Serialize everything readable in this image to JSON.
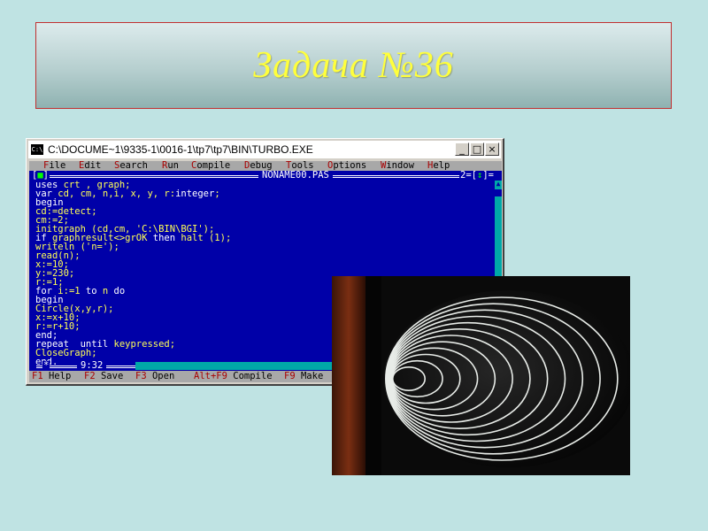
{
  "slide": {
    "title": "Задача №36",
    "background_color": "#bfe3e3",
    "title_color": "#ffff3c"
  },
  "window": {
    "title": "C:\\DOCUME~1\\9335-1\\0016-1\\tp7\\tp7\\BIN\\TURBO.EXE",
    "app_icon": "C:\\",
    "controls": {
      "minimize": "_",
      "maximize": "□",
      "close": "×"
    }
  },
  "ide": {
    "menu": [
      {
        "hot": "F",
        "rest": "ile"
      },
      {
        "hot": "E",
        "rest": "dit"
      },
      {
        "hot": "S",
        "rest": "earch"
      },
      {
        "hot": "R",
        "rest": "un"
      },
      {
        "hot": "C",
        "rest": "ompile"
      },
      {
        "hot": "D",
        "rest": "ebug"
      },
      {
        "hot": "T",
        "rest": "ools"
      },
      {
        "hot": "O",
        "rest": "ptions"
      },
      {
        "hot": "W",
        "rest": "indow"
      },
      {
        "hot": "H",
        "rest": "elp"
      }
    ],
    "close_box": {
      "left": "[",
      "mark": "■",
      "right": "]"
    },
    "filename": "NONAME00.PAS",
    "window_number": {
      "num": "2",
      "left": "=[",
      "mark": "↕",
      "right": "]="
    },
    "code": [
      [
        {
          "t": "uses ",
          "c": "kw"
        },
        {
          "t": "crt , graph;",
          "c": "id"
        }
      ],
      [
        {
          "t": "var ",
          "c": "kw"
        },
        {
          "t": "cd, cm, n,i, x, y, r:",
          "c": "id"
        },
        {
          "t": "integer",
          "c": "kw"
        },
        {
          "t": ";",
          "c": "id"
        }
      ],
      [
        {
          "t": "begin",
          "c": "kw"
        }
      ],
      [
        {
          "t": "cd:=detect;",
          "c": "id"
        }
      ],
      [
        {
          "t": "cm:=2;",
          "c": "id"
        }
      ],
      [
        {
          "t": "initgraph (cd,cm, 'C:\\BIN\\BGI');",
          "c": "id"
        }
      ],
      [
        {
          "t": "if ",
          "c": "kw"
        },
        {
          "t": "graphresult<>grOK ",
          "c": "id"
        },
        {
          "t": "then ",
          "c": "kw"
        },
        {
          "t": "halt (1);",
          "c": "id"
        }
      ],
      [
        {
          "t": "writeln ('n=');",
          "c": "id"
        }
      ],
      [
        {
          "t": "read(n);",
          "c": "id"
        }
      ],
      [
        {
          "t": "x:=10;",
          "c": "id"
        }
      ],
      [
        {
          "t": "y:=230;",
          "c": "id"
        }
      ],
      [
        {
          "t": "r:=1;",
          "c": "id"
        }
      ],
      [
        {
          "t": "for ",
          "c": "kw"
        },
        {
          "t": "i:=1 ",
          "c": "id"
        },
        {
          "t": "to ",
          "c": "kw"
        },
        {
          "t": "n ",
          "c": "id"
        },
        {
          "t": "do",
          "c": "kw"
        }
      ],
      [
        {
          "t": "begin",
          "c": "kw"
        }
      ],
      [
        {
          "t": "Circle(x,y,r);",
          "c": "id"
        }
      ],
      [
        {
          "t": "x:=x+10;",
          "c": "id"
        }
      ],
      [
        {
          "t": "r:=r+10;",
          "c": "id"
        }
      ],
      [
        {
          "t": "end;",
          "c": "kw"
        }
      ],
      [
        {
          "t": "repeat  until ",
          "c": "kw"
        },
        {
          "t": "keypressed;",
          "c": "id"
        }
      ],
      [
        {
          "t": "CloseGraph;",
          "c": "id"
        }
      ],
      [
        {
          "t": "end.",
          "c": "kw"
        }
      ]
    ],
    "scroll_up": "▲",
    "star": "*",
    "cursor_pos": "9:32",
    "status": [
      {
        "key": "F1",
        "label": " Help"
      },
      {
        "key": "F2",
        "label": " Save"
      },
      {
        "key": "F3",
        "label": " Open"
      },
      {
        "key": "Alt+F9",
        "label": " Compile"
      },
      {
        "key": "F9",
        "label": " Make"
      }
    ]
  },
  "photo": {
    "description_icon": "concentric-circles-output",
    "background": "#0b0b0b",
    "ring_color": "#e8ece8",
    "ring_count": 12
  }
}
